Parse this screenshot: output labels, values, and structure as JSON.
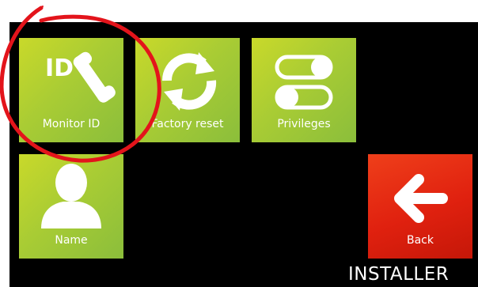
{
  "menu": {
    "tiles": [
      {
        "label": "Monitor ID",
        "icon": "monitor-id-phone-icon"
      },
      {
        "label": "Factory reset",
        "icon": "factory-reset-icon"
      },
      {
        "label": "Privileges",
        "icon": "privileges-toggle-icon"
      },
      {
        "label": "Name",
        "icon": "user-silhouette-icon"
      }
    ],
    "back": {
      "label": "Back",
      "icon": "arrow-left-icon"
    }
  },
  "screen": {
    "title": "INSTALLER"
  },
  "icon_text": {
    "id_badge": "ID"
  },
  "colors": {
    "tile_green": "#a9cc34",
    "tile_red": "#e0210f",
    "background": "#000000",
    "annotation_circle": "#e3141b"
  }
}
